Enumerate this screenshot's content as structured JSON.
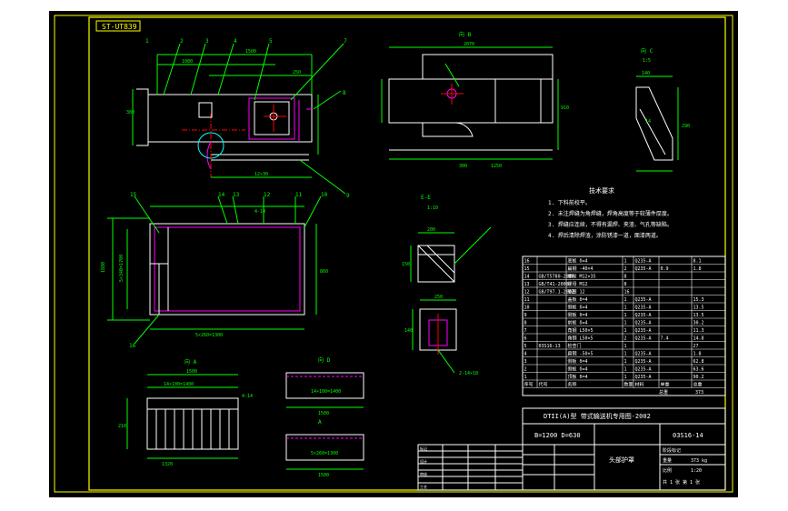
{
  "drawing": {
    "tag": "ST-UT839",
    "title_main": "DTII(A)型 带式输送机专用图-2002",
    "spec": "B=1200 D=630",
    "drawing_no": "03S16-14",
    "part_name": "头部护罩",
    "weight": "373 kg",
    "scale": "1:20"
  },
  "views": {
    "a": "A",
    "b_label": "B",
    "view_a": "向 A",
    "view_b": "向 B",
    "view_c": "向 C",
    "view_d": "向 D",
    "section_e": "E-E",
    "section_f": "F-F",
    "scale_small": "1:10",
    "scale_view": "1:5"
  },
  "dims": {
    "d1500": "1500",
    "d1380": "1380",
    "d2070": "2070",
    "d910": "910",
    "d1250": "1250",
    "d300": "300",
    "d210": "210",
    "d290": "290",
    "d1080": "1080",
    "d250": "250",
    "d380": "380",
    "d1840": "1840",
    "d540": "5×340=1700",
    "d1225": "12×30",
    "d860": "860",
    "d1200": "1200",
    "d1880": "1880",
    "d1750": "1750",
    "d1320": "1320",
    "d5x260": "5×260=1300",
    "d14x100": "14×100=1400",
    "d150": "150",
    "d14": "14",
    "d200": "200",
    "d140": "140",
    "d4x14": "4-14",
    "d2x14": "2-14×18"
  },
  "callouts": [
    "1",
    "2",
    "3",
    "4",
    "5",
    "6",
    "7",
    "8",
    "9",
    "10",
    "11",
    "12",
    "13",
    "14",
    "15",
    "16"
  ],
  "notes": {
    "heading": "技术要求",
    "n1": "1. 下料前校平。",
    "n2": "2. 未注焊缝为角焊缝，焊角高度等于较薄件厚度。",
    "n3": "3. 焊缝应连续，不得有漏焊、夹渣、气孔等缺陷。",
    "n4": "4. 焊后清除焊渣，涂防锈漆一道，面漆两道。"
  },
  "bom": {
    "header": [
      "序号",
      "代号",
      "名称",
      "数量",
      "材料",
      "单重",
      "总重"
    ],
    "rows": [
      [
        "16",
        "",
        "底板 δ=4",
        "1",
        "Q235-A",
        "",
        "8.1"
      ],
      [
        "15",
        "",
        "扁钢 -40×4",
        "2",
        "Q235-A",
        "0.9",
        "1.8"
      ],
      [
        "14",
        "GB/T5780-2000",
        "螺栓 M12×35",
        "8",
        "",
        "",
        ""
      ],
      [
        "13",
        "GB/T41-2000",
        "螺母 M12",
        "8",
        "",
        "",
        ""
      ],
      [
        "12",
        "GB/T97.1-2002",
        "垫圈 12",
        "16",
        "",
        "",
        ""
      ],
      [
        "11",
        "",
        "盖板 δ=4",
        "1",
        "Q235-A",
        "",
        "15.3"
      ],
      [
        "10",
        "",
        "侧板 δ=4",
        "1",
        "Q235-A",
        "",
        "13.5"
      ],
      [
        "9",
        "",
        "侧板 δ=4",
        "1",
        "Q235-A",
        "",
        "13.5"
      ],
      [
        "8",
        "",
        "前板 δ=4",
        "1",
        "Q235-A",
        "",
        "30.2"
      ],
      [
        "7",
        "",
        "角钢 L50×5",
        "1",
        "Q235-A",
        "",
        "11.3"
      ],
      [
        "6",
        "",
        "角钢 L50×5",
        "2",
        "Q235-A",
        "7.4",
        "14.8"
      ],
      [
        "5",
        "03S16-13",
        "检查门",
        "1",
        "",
        "",
        "27"
      ],
      [
        "4",
        "",
        "扁钢 -50×5",
        "1",
        "Q235-A",
        "",
        "1.8"
      ],
      [
        "3",
        "",
        "侧板 δ=4",
        "1",
        "Q235-A",
        "",
        "62.8"
      ],
      [
        "2",
        "",
        "侧板 δ=4",
        "1",
        "Q235-A",
        "",
        "63.6"
      ],
      [
        "1",
        "",
        "顶板 δ=4",
        "1",
        "Q235-A",
        "",
        "90.2"
      ]
    ],
    "footer_total_label": "总重",
    "footer_total": "373"
  },
  "title_block": {
    "rev_rows": [
      [
        "标记",
        "处数",
        "分区",
        "更改文件号",
        "签名",
        "日期"
      ],
      [
        "设计",
        "",
        "",
        "标准化",
        "",
        ""
      ],
      [
        "审核",
        "",
        "",
        "",
        "",
        ""
      ],
      [
        "工艺",
        "",
        "",
        "批准",
        "",
        ""
      ]
    ],
    "stage_label": "阶段标记",
    "weight_label": "重量",
    "scale_label": "比例",
    "sheet": "共 1 张 第 1 张"
  },
  "colors": {
    "background": "#000000",
    "frame_border": "#ffff00",
    "geometry": "#ffffff",
    "dimension": "#00ff00",
    "centerline": "#ff0000",
    "detail": "#ff00ff",
    "hatch": "#00ffff"
  }
}
